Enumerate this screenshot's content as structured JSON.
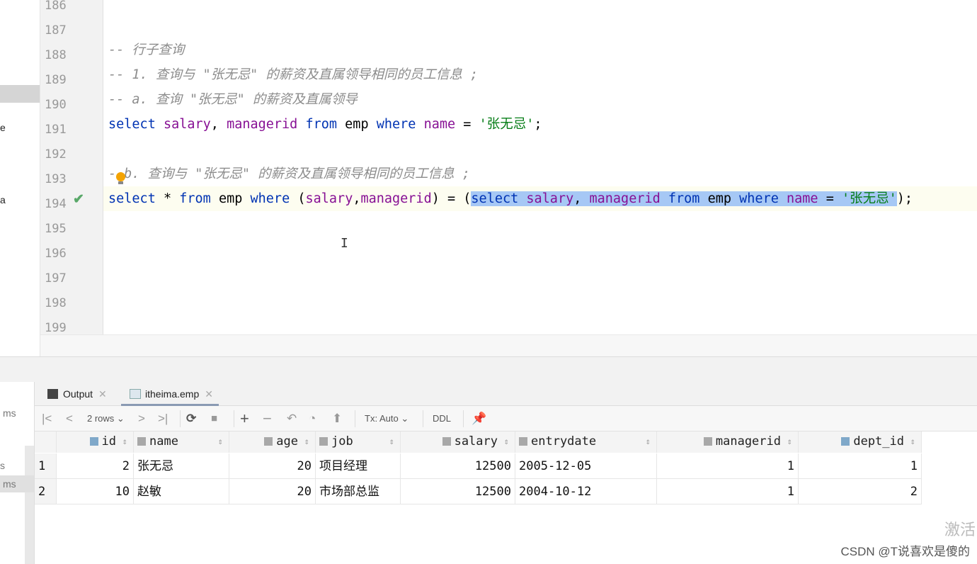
{
  "left_panel": {
    "fragments": [
      "e",
      "a"
    ]
  },
  "bottom_left": {
    "fragments": [
      "ms",
      "s",
      "ms"
    ]
  },
  "editor": {
    "line_numbers": [
      "186",
      "187",
      "188",
      "189",
      "190",
      "191",
      "192",
      "193",
      "194",
      "195",
      "196",
      "197",
      "198",
      "199"
    ],
    "lines": {
      "l188": "-- 行子查询",
      "l189": "-- 1. 查询与 \"张无忌\" 的薪资及直属领导相同的员工信息 ;",
      "l190": "-- a. 查询 \"张无忌\" 的薪资及直属领导",
      "l191": {
        "k1": "select",
        "c1": "salary",
        "p1": ", ",
        "c2": "managerid",
        "k2": "from",
        "t": "emp",
        "k3": "where",
        "c3": "name",
        "op": "=",
        "s": "'张无忌'",
        "end": ";"
      },
      "l193": "b. 查询与 \"张无忌\" 的薪资及直属领导相同的员工信息 ;",
      "l194": {
        "k1": "select",
        "star": "*",
        "k2": "from",
        "t": "emp",
        "k3": "where",
        "c1": "salary",
        "c2": "managerid",
        "sk1": "select",
        "sc1": "salary",
        "sc2": "managerid",
        "sk2": "from",
        "st": "emp",
        "sk3": "where",
        "sc3": "name",
        "ss": "'张无忌'"
      }
    }
  },
  "results": {
    "tabs": [
      {
        "label": "Output",
        "icon": "console-icon"
      },
      {
        "label": "itheima.emp",
        "icon": "table-icon",
        "active": true
      }
    ],
    "toolbar": {
      "rows": "2 rows",
      "tx": "Tx: Auto",
      "ddl": "DDL"
    },
    "columns": [
      "id",
      "name",
      "age",
      "job",
      "salary",
      "entrydate",
      "managerid",
      "dept_id"
    ],
    "rows": [
      [
        "1",
        "2",
        "张无忌",
        "20",
        "项目经理",
        "12500",
        "2005-12-05",
        "1",
        "1"
      ],
      [
        "2",
        "10",
        "赵敏",
        "20",
        "市场部总监",
        "12500",
        "2004-10-12",
        "1",
        "2"
      ]
    ]
  },
  "watermark": {
    "text": "CSDN @T说喜欢是傻的",
    "activate": "激活"
  },
  "colors": {
    "keyword": "#0033b3",
    "column": "#871094",
    "string": "#067d17",
    "comment": "#8c8c8c",
    "selection": "#a6c8f5"
  }
}
